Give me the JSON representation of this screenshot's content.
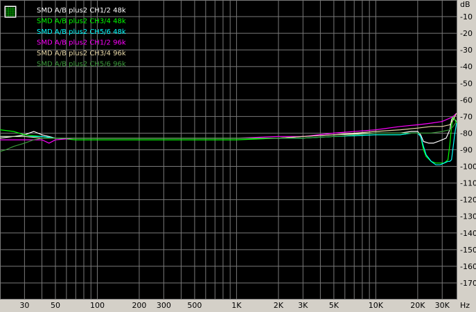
{
  "chart_data": {
    "type": "line",
    "title": "",
    "xlabel": "",
    "ylabel": "",
    "x_unit": "Hz",
    "y_unit": "dB",
    "x_scale": "log",
    "xlim": [
      20,
      40000
    ],
    "ylim": [
      -180,
      0
    ],
    "background": "#000000",
    "grid": true,
    "grid_color": "#7a7a7a",
    "legend_position": "top-left",
    "x_ticks": [
      {
        "value": 30,
        "label": "30"
      },
      {
        "value": 50,
        "label": "50"
      },
      {
        "value": 100,
        "label": "100"
      },
      {
        "value": 200,
        "label": "200"
      },
      {
        "value": 300,
        "label": "300"
      },
      {
        "value": 500,
        "label": "500"
      },
      {
        "value": 1000,
        "label": "1K"
      },
      {
        "value": 2000,
        "label": "2K"
      },
      {
        "value": 3000,
        "label": "3K"
      },
      {
        "value": 5000,
        "label": "5K"
      },
      {
        "value": 10000,
        "label": "10K"
      },
      {
        "value": 20000,
        "label": "20K"
      },
      {
        "value": 30000,
        "label": "30K"
      }
    ],
    "y_ticks": [
      {
        "value": -10,
        "label": "-10"
      },
      {
        "value": -20,
        "label": "-20"
      },
      {
        "value": -30,
        "label": "-30"
      },
      {
        "value": -40,
        "label": "-40"
      },
      {
        "value": -50,
        "label": "-50"
      },
      {
        "value": -60,
        "label": "-60"
      },
      {
        "value": -70,
        "label": "-70"
      },
      {
        "value": -80,
        "label": "-80"
      },
      {
        "value": -90,
        "label": "-90"
      },
      {
        "value": -100,
        "label": "-100"
      },
      {
        "value": -110,
        "label": "-110"
      },
      {
        "value": -120,
        "label": "-120"
      },
      {
        "value": -130,
        "label": "-130"
      },
      {
        "value": -140,
        "label": "-140"
      },
      {
        "value": -150,
        "label": "-150"
      },
      {
        "value": -160,
        "label": "-160"
      },
      {
        "value": -170,
        "label": "-170"
      }
    ],
    "series": [
      {
        "name": "SMD A/B plus2 CH1/2 48k",
        "color": "#ffffff",
        "points": [
          [
            20,
            -83
          ],
          [
            25,
            -82
          ],
          [
            30,
            -81
          ],
          [
            35,
            -79
          ],
          [
            40,
            -81
          ],
          [
            50,
            -83
          ],
          [
            70,
            -83
          ],
          [
            100,
            -83
          ],
          [
            200,
            -83
          ],
          [
            300,
            -83
          ],
          [
            500,
            -83
          ],
          [
            1000,
            -83
          ],
          [
            2000,
            -83
          ],
          [
            3000,
            -82
          ],
          [
            5000,
            -81
          ],
          [
            10000,
            -80
          ],
          [
            15000,
            -80
          ],
          [
            18000,
            -79
          ],
          [
            20000,
            -79
          ],
          [
            21000,
            -81
          ],
          [
            22000,
            -85
          ],
          [
            24000,
            -86
          ],
          [
            26000,
            -86
          ],
          [
            28000,
            -85
          ],
          [
            30000,
            -84
          ],
          [
            32000,
            -83
          ],
          [
            34000,
            -78
          ],
          [
            35000,
            -72
          ],
          [
            36000,
            -70
          ],
          [
            37000,
            -72
          ],
          [
            38000,
            -73
          ]
        ]
      },
      {
        "name": "SMD A/B plus2 CH3/4 48k",
        "color": "#00ff00",
        "points": [
          [
            20,
            -78
          ],
          [
            25,
            -79
          ],
          [
            30,
            -81
          ],
          [
            40,
            -82
          ],
          [
            50,
            -83
          ],
          [
            70,
            -84
          ],
          [
            100,
            -84
          ],
          [
            200,
            -84
          ],
          [
            300,
            -84
          ],
          [
            500,
            -84
          ],
          [
            1000,
            -84
          ],
          [
            2000,
            -83
          ],
          [
            3000,
            -83
          ],
          [
            5000,
            -82
          ],
          [
            10000,
            -81
          ],
          [
            15000,
            -81
          ],
          [
            18000,
            -80
          ],
          [
            20000,
            -80
          ],
          [
            21000,
            -82
          ],
          [
            22000,
            -90
          ],
          [
            23000,
            -94
          ],
          [
            25000,
            -97
          ],
          [
            27000,
            -98
          ],
          [
            29000,
            -98
          ],
          [
            31000,
            -98
          ],
          [
            33000,
            -96
          ],
          [
            34000,
            -87
          ],
          [
            35000,
            -76
          ],
          [
            36000,
            -70
          ],
          [
            37000,
            -72
          ],
          [
            38000,
            -74
          ]
        ]
      },
      {
        "name": "SMD A/B plus2 CH5/6 48k",
        "color": "#00ffff",
        "points": [
          [
            20,
            -82
          ],
          [
            25,
            -82
          ],
          [
            30,
            -82
          ],
          [
            40,
            -82
          ],
          [
            50,
            -83
          ],
          [
            70,
            -83
          ],
          [
            100,
            -83
          ],
          [
            200,
            -83
          ],
          [
            300,
            -83
          ],
          [
            500,
            -83
          ],
          [
            1000,
            -83
          ],
          [
            2000,
            -83
          ],
          [
            3000,
            -83
          ],
          [
            5000,
            -82
          ],
          [
            10000,
            -81
          ],
          [
            15000,
            -81
          ],
          [
            18000,
            -80
          ],
          [
            20000,
            -80
          ],
          [
            21000,
            -82
          ],
          [
            22000,
            -88
          ],
          [
            23000,
            -93
          ],
          [
            25000,
            -97
          ],
          [
            27000,
            -99
          ],
          [
            29000,
            -99
          ],
          [
            31000,
            -98
          ],
          [
            33000,
            -97
          ],
          [
            34000,
            -97
          ],
          [
            35000,
            -96
          ],
          [
            36000,
            -88
          ],
          [
            37000,
            -80
          ],
          [
            38000,
            -74
          ]
        ]
      },
      {
        "name": "SMD A/B plus2 CH1/2 96k",
        "color": "#ff00ff",
        "points": [
          [
            20,
            -84
          ],
          [
            25,
            -84
          ],
          [
            30,
            -84
          ],
          [
            35,
            -84
          ],
          [
            40,
            -84
          ],
          [
            45,
            -86
          ],
          [
            50,
            -84
          ],
          [
            70,
            -83
          ],
          [
            100,
            -83
          ],
          [
            200,
            -83
          ],
          [
            300,
            -83
          ],
          [
            500,
            -83
          ],
          [
            1000,
            -83
          ],
          [
            2000,
            -82
          ],
          [
            3000,
            -82
          ],
          [
            5000,
            -80
          ],
          [
            10000,
            -78
          ],
          [
            15000,
            -76
          ],
          [
            20000,
            -75
          ],
          [
            25000,
            -74
          ],
          [
            30000,
            -73
          ],
          [
            34000,
            -71
          ],
          [
            36000,
            -70
          ],
          [
            38000,
            -68
          ]
        ]
      },
      {
        "name": "SMD A/B plus2 CH3/4 96k",
        "color": "#e8d8a8",
        "points": [
          [
            20,
            -82
          ],
          [
            25,
            -82
          ],
          [
            30,
            -82
          ],
          [
            40,
            -83
          ],
          [
            50,
            -83
          ],
          [
            70,
            -83
          ],
          [
            100,
            -83
          ],
          [
            200,
            -83
          ],
          [
            300,
            -83
          ],
          [
            500,
            -83
          ],
          [
            1000,
            -83
          ],
          [
            2000,
            -83
          ],
          [
            3000,
            -82
          ],
          [
            5000,
            -81
          ],
          [
            10000,
            -79
          ],
          [
            15000,
            -78
          ],
          [
            20000,
            -77
          ],
          [
            25000,
            -76
          ],
          [
            30000,
            -76
          ],
          [
            34000,
            -75
          ],
          [
            36000,
            -72
          ],
          [
            38000,
            -68
          ]
        ]
      },
      {
        "name": "SMD A/B plus2 CH5/6 96k",
        "color": "#3a9a3a",
        "points": [
          [
            20,
            -91
          ],
          [
            22,
            -90
          ],
          [
            25,
            -88
          ],
          [
            30,
            -86
          ],
          [
            35,
            -84
          ],
          [
            40,
            -83
          ],
          [
            50,
            -83
          ],
          [
            70,
            -83
          ],
          [
            100,
            -83
          ],
          [
            200,
            -83
          ],
          [
            300,
            -83
          ],
          [
            500,
            -83
          ],
          [
            1000,
            -83
          ],
          [
            2000,
            -83
          ],
          [
            3000,
            -83
          ],
          [
            5000,
            -82
          ],
          [
            10000,
            -80
          ],
          [
            15000,
            -80
          ],
          [
            20000,
            -80
          ],
          [
            25000,
            -80
          ],
          [
            30000,
            -79
          ],
          [
            34000,
            -78
          ],
          [
            36000,
            -76
          ],
          [
            38000,
            -73
          ]
        ]
      }
    ]
  },
  "legend_icon": "grid-icon"
}
